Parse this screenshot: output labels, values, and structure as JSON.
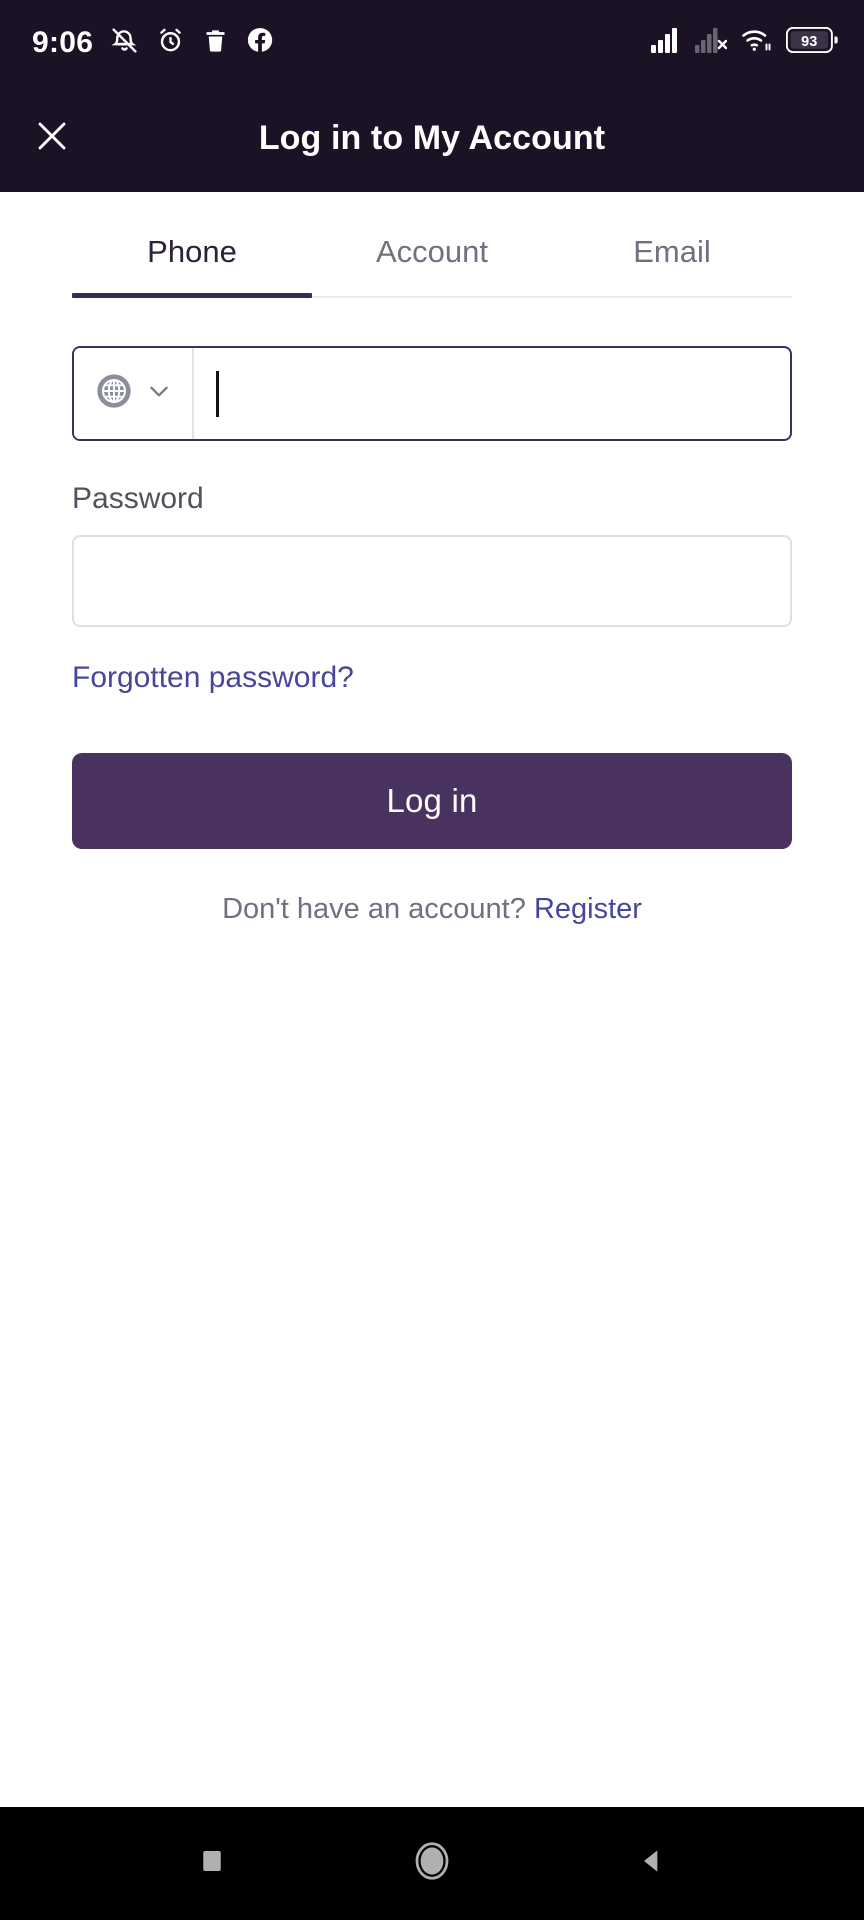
{
  "status_bar": {
    "time": "9:06",
    "battery_level": "93",
    "left_icons": [
      "notifications-off-icon",
      "alarm-icon",
      "trash-icon",
      "facebook-icon"
    ],
    "right_icons": [
      "signal-sim1-icon",
      "signal-sim2-no-service-icon",
      "wifi-icon",
      "battery-icon"
    ],
    "background_color": "#1B1226"
  },
  "app_bar": {
    "title": "Log in to My Account",
    "close_icon": "close-icon",
    "background_color": "#1B1226",
    "text_color": "#FFFFFF"
  },
  "tabs": {
    "active_index": 0,
    "items": [
      {
        "label": "Phone",
        "active": true
      },
      {
        "label": "Account",
        "active": false
      },
      {
        "label": "Email",
        "active": false
      }
    ],
    "active_color": "#2B2139",
    "inactive_color": "#6E7180",
    "indicator_color": "#3A2C4E"
  },
  "form": {
    "phone": {
      "country_icon": "globe-icon",
      "dropdown_icon": "chevron-down-icon",
      "value": "",
      "placeholder": "",
      "focused": true,
      "border_color": "#3A2F63"
    },
    "password": {
      "label": "Password",
      "value": "",
      "placeholder": "",
      "border_color": "#DFDFE4"
    },
    "forgot_password_label": "Forgotten password?",
    "forgot_password_color": "#46479B",
    "login_button_label": "Log in",
    "login_button_color": "#4A3260",
    "register_prompt": "Don't have an account? ",
    "register_label": "Register",
    "register_color": "#46479B"
  },
  "nav_bar": {
    "buttons": [
      "recents-square-icon",
      "home-circle-icon",
      "back-triangle-icon"
    ],
    "background_color": "#000000",
    "icon_color": "#B0B0B0"
  }
}
